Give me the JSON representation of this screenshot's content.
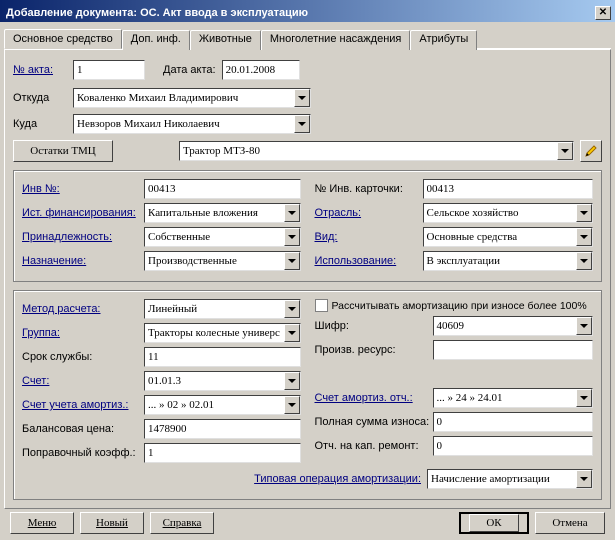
{
  "window": {
    "title": "Добавление документа: ОС. Акт ввода в эксплуатацию"
  },
  "tabs": [
    "Основное средство",
    "Доп. инф.",
    "Животные",
    "Многолетние насаждения",
    "Атрибуты"
  ],
  "top": {
    "act_no_label": "№ акта:",
    "act_no": "1",
    "act_date_label": "Дата акта:",
    "act_date": "20.01.2008",
    "from_label": "Откуда",
    "from": "Коваленко  Михаил  Владимирович",
    "to_label": "Куда",
    "to": "Невзоров  Михаил  Николаевич",
    "remains_btn": "Остатки ТМЦ",
    "item": "Трактор МТЗ-80"
  },
  "g1": {
    "inv_no_label": "Инв №:",
    "inv_no": "00413",
    "card_no_label": "№ Инв. карточки:",
    "card_no": "00413",
    "fin_label": "Ист. финансирования:",
    "fin": "Капитальные вложения",
    "branch_label": "Отрасль:",
    "branch": "Сельское хозяйство",
    "own_label": "Принадлежность:",
    "own": "Собственные",
    "kind_label": "Вид:",
    "kind": "Основные средства",
    "purpose_label": "Назначение:",
    "purpose": "Производственные",
    "use_label": "Использование:",
    "use": "В эксплуатации"
  },
  "g2": {
    "method_label": "Метод расчета:",
    "method": "Линейный",
    "chk_label": "Рассчитывать амортизацию при износе более 100%",
    "group_label": "Группа:",
    "group": "Тракторы колесные универс",
    "code_label": "Шифр:",
    "code": "40609",
    "life_label": "Срок службы:",
    "life": "11",
    "res_label": "Произв. ресурс:",
    "res": "",
    "acct_label": "Счет:",
    "acct": "01.01.3",
    "amacct_label": "Счет учета амортиз.:",
    "amacct": "... » 02 » 02.01",
    "amded_label": "Счет амортиз. отч.:",
    "amded": "... » 24 » 24.01",
    "bal_label": "Балансовая цена:",
    "bal": "1478900",
    "wear_label": "Полная сумма износа:",
    "wear": "0",
    "coef_label": "Поправочный коэфф.:",
    "coef": "1",
    "cap_label": "Отч. на кап. ремонт:",
    "cap": "0",
    "typeop_label": "Типовая операция амортизации:",
    "typeop": "Начисление амортизации"
  },
  "footer": {
    "menu": "Меню",
    "new": "Новый",
    "help": "Справка",
    "ok": "ОК",
    "cancel": "Отмена"
  }
}
